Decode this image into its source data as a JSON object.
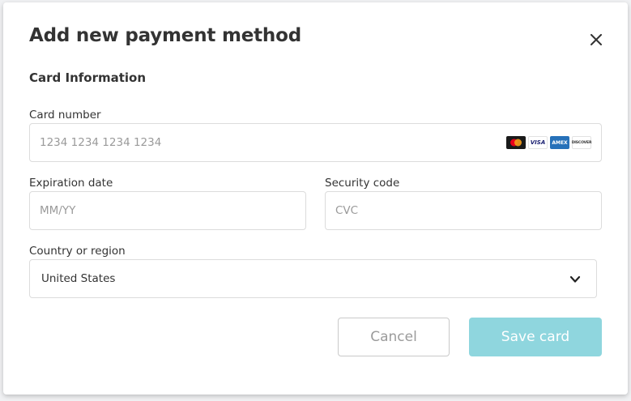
{
  "dialog": {
    "title": "Add new payment method",
    "section": "Card Information"
  },
  "card_number": {
    "label": "Card number",
    "placeholder": "1234 1234 1234 1234",
    "brands": [
      {
        "name": "mastercard-icon"
      },
      {
        "name": "visa-icon",
        "text": "VISA"
      },
      {
        "name": "amex-icon",
        "text": "AMEX"
      },
      {
        "name": "discover-icon",
        "text": "DISCOVER"
      }
    ]
  },
  "expiration": {
    "label": "Expiration date",
    "placeholder": "MM/YY"
  },
  "security": {
    "label": "Security code",
    "placeholder": "CVC"
  },
  "country": {
    "label": "Country or region",
    "value": "United States"
  },
  "buttons": {
    "cancel": "Cancel",
    "save": "Save card"
  },
  "colors": {
    "accent": "#8fd6de",
    "border": "#dcdcdc",
    "mastercard_red": "#eb001b",
    "mastercard_yellow": "#f79e1b"
  }
}
